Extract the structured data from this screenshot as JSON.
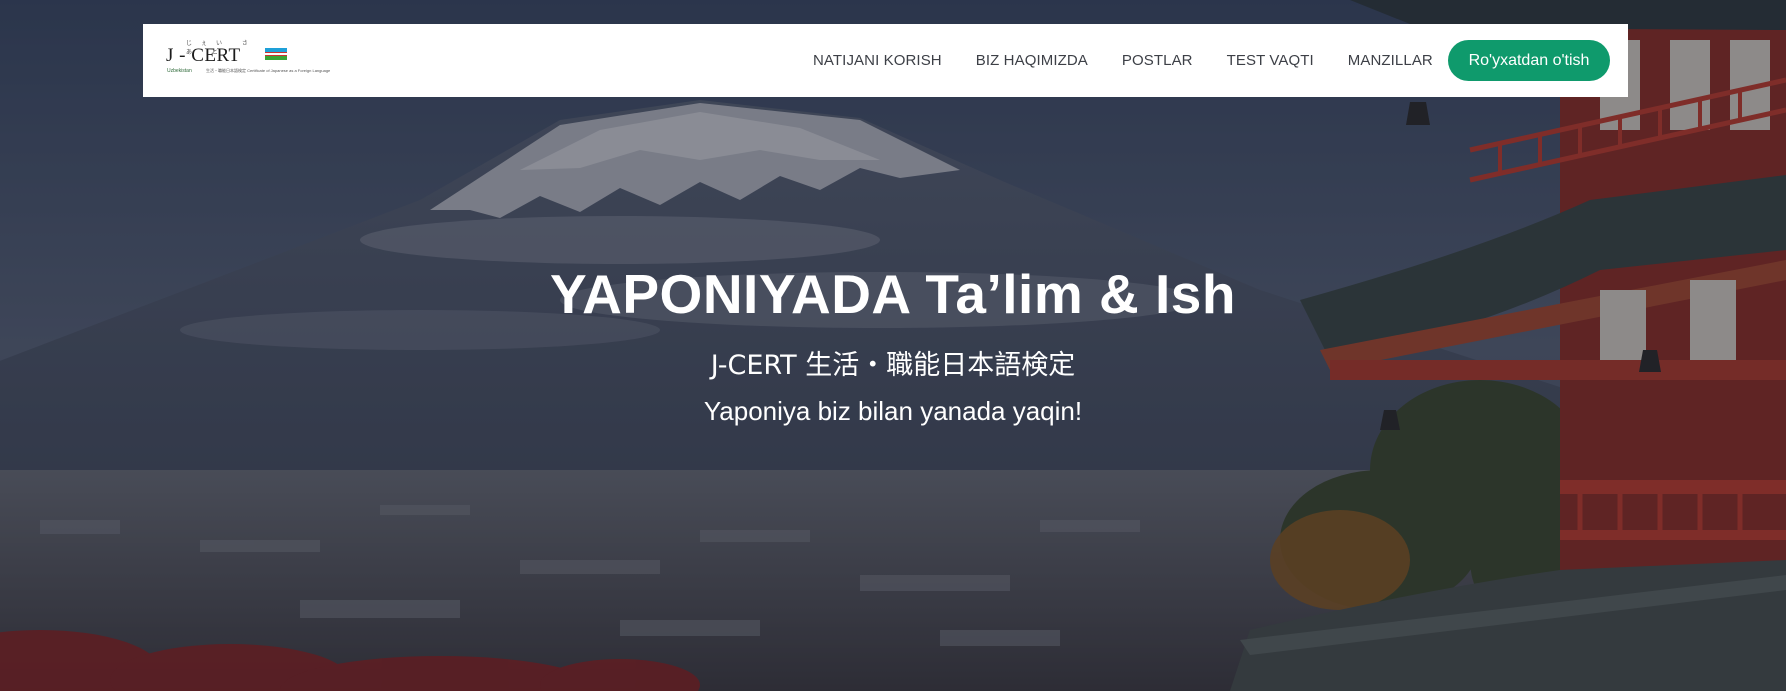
{
  "header": {
    "logo": {
      "brand_text": "J - CERT",
      "kana_text": "じぇい さ あ と",
      "sub_text": "Uzbekistan",
      "caption": "生活・職能日本語検定 Certificate of Japanese as a Foreign Language"
    },
    "nav": [
      {
        "label": "NATIJANI KORISH"
      },
      {
        "label": "BIZ HAQIMIZDA"
      },
      {
        "label": "POSTLAR"
      },
      {
        "label": "TEST VAQTI"
      },
      {
        "label": "MANZILLAR"
      }
    ],
    "cta_label": "Ro'yxatdan o'tish"
  },
  "hero": {
    "title": "YAPONIYADA Ta’lim & Ish",
    "subtitle": "J-CERT 生活・職能日本語検定",
    "tagline": "Yaponiya biz bilan yanada yaqin!"
  },
  "colors": {
    "accent": "#0f9a6c",
    "navbar_bg": "#ffffff",
    "nav_text": "#3d4047",
    "hero_text": "#ffffff",
    "flag_blue": "#1ea0d8",
    "flag_white": "#ffffff",
    "flag_green": "#3aa536"
  }
}
